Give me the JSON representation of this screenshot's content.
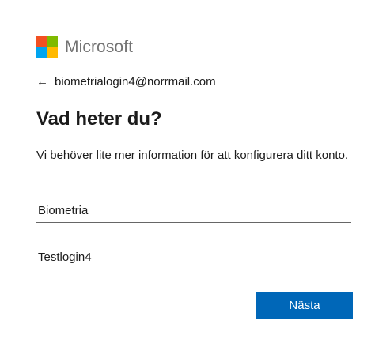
{
  "brand": {
    "name": "Microsoft",
    "logo_colors": [
      "#f25022",
      "#7fba00",
      "#00a4ef",
      "#ffb900"
    ]
  },
  "header": {
    "back_icon": "arrow-left-icon",
    "email": "biometrialogin4@norrmail.com"
  },
  "title": "Vad heter du?",
  "description": "Vi behöver lite mer information för att konfigurera ditt konto.",
  "form": {
    "first_name_value": "Biometria",
    "last_name_value": "Testlogin4"
  },
  "buttons": {
    "next_label": "Nästa",
    "next_color": "#0067b8"
  }
}
